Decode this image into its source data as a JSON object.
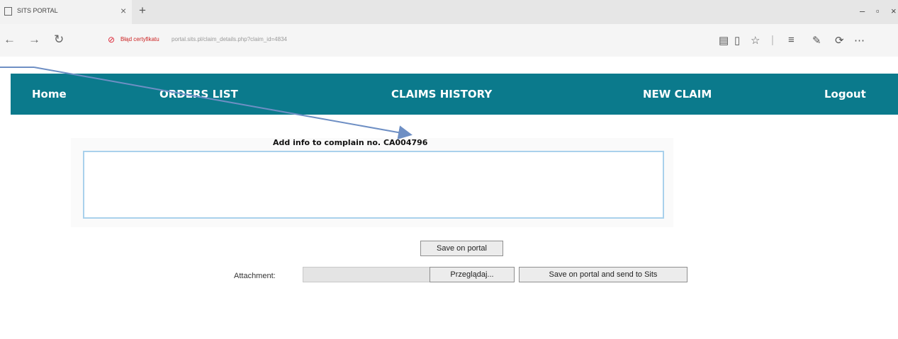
{
  "browser": {
    "tab_title": "SITS PORTAL",
    "tab_close": "×",
    "new_tab": "+",
    "window_minimize": "–",
    "window_maximize": "▫",
    "window_close": "×",
    "back": "←",
    "forward": "→",
    "refresh": "↻",
    "cert_warning": "Błąd certyfikatu",
    "url": "portal.sits.pl/claim_details.php?claim_id=4834"
  },
  "nav": {
    "home": "Home",
    "orders": "ORDERS LIST",
    "claims_history": "CLAIMS HISTORY",
    "new_claim": "NEW CLAIM",
    "logout": "Logout"
  },
  "form": {
    "title": "Add info to complain no. CA004796",
    "info_value": "",
    "save_portal": "Save on portal",
    "attachment_label": "Attachment:",
    "browse": "Przeglądaj...",
    "save_send": "Save on portal and send to Sits"
  }
}
